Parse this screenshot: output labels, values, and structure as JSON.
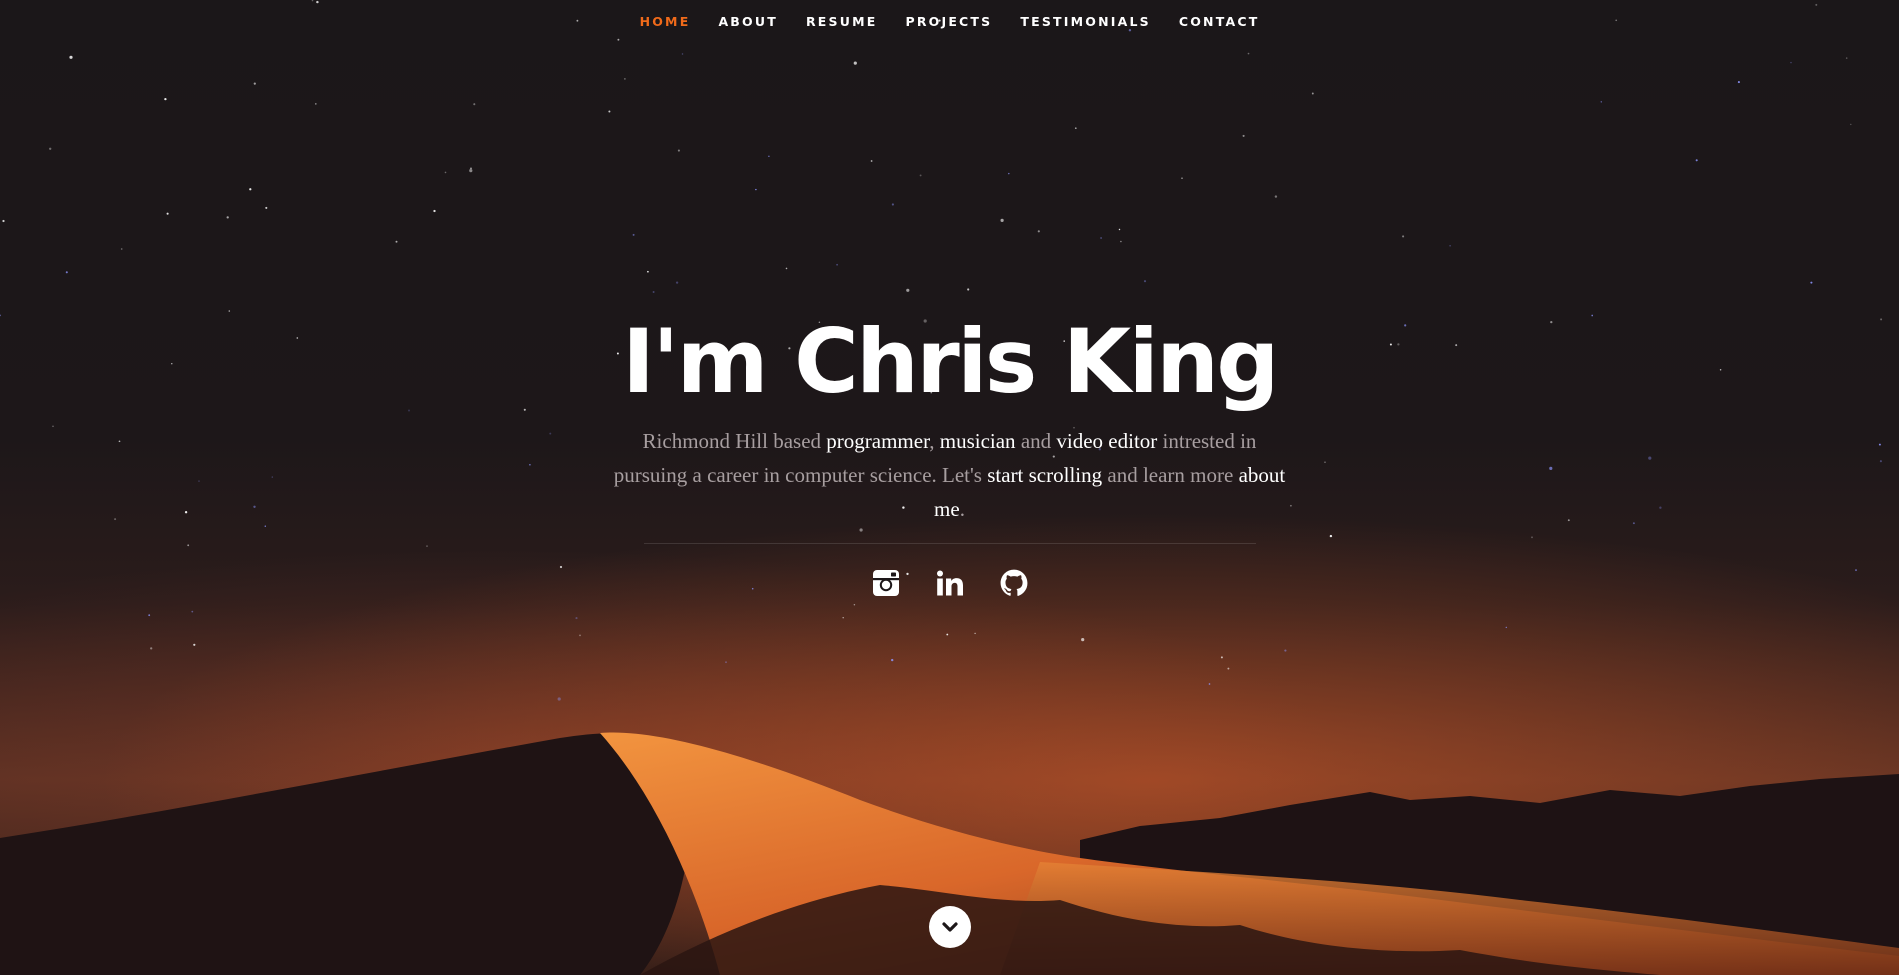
{
  "nav": {
    "items": [
      {
        "label": "HOME",
        "active": true
      },
      {
        "label": "ABOUT",
        "active": false
      },
      {
        "label": "RESUME",
        "active": false
      },
      {
        "label": "PROJECTS",
        "active": false
      },
      {
        "label": "TESTIMONIALS",
        "active": false
      },
      {
        "label": "CONTACT",
        "active": false
      }
    ]
  },
  "banner": {
    "headline": "I'm Chris King",
    "tagline": {
      "t1": "Richmond Hill based ",
      "h1": "programmer",
      "t2": ", ",
      "h2": "musician",
      "t3": " and ",
      "h3": "video editor",
      "t4": " intrested in pursuing a career in computer science. Let's ",
      "h4": "start scrolling",
      "t5": " and learn more ",
      "h5": "about me",
      "t6": "."
    }
  },
  "social": {
    "icons": [
      "instagram-icon",
      "linkedin-icon",
      "github-icon"
    ]
  },
  "scroll_icon": "chevron-down-icon",
  "colors": {
    "accent": "#f06a1a",
    "nav_text": "#ffffff",
    "headline": "#ffffff",
    "tagline_text": "#a79ea0",
    "tagline_highlight": "#ffffff",
    "sky": "#1b1719",
    "dune_glow": "#e07a2e"
  }
}
